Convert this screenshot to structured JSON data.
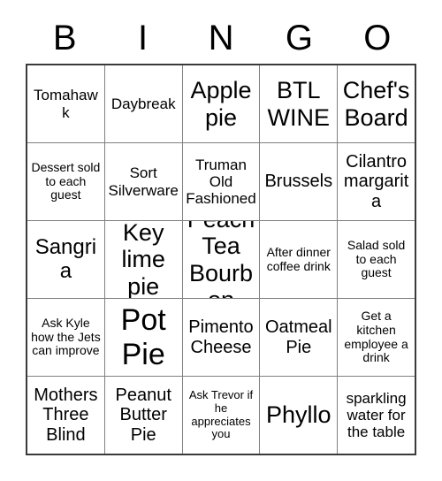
{
  "card": {
    "header_letters": [
      "B",
      "I",
      "N",
      "G",
      "O"
    ],
    "columns": 5,
    "rows": 5,
    "colors": {
      "background": "#ffffff",
      "text": "#000000",
      "outer_border": "#3a3a3a",
      "inner_border": "#808080"
    },
    "cells": [
      [
        {
          "text": "Tomahawk",
          "size": "sm"
        },
        {
          "text": "Daybreak",
          "size": "sm"
        },
        {
          "text": "Apple pie",
          "size": "xl"
        },
        {
          "text": "BTL WINE",
          "size": "xl"
        },
        {
          "text": "Chef's Board",
          "size": "xl"
        }
      ],
      [
        {
          "text": "Dessert sold to each guest",
          "size": "xs"
        },
        {
          "text": "Sort Silverware",
          "size": "sm"
        },
        {
          "text": "Truman Old Fashioned",
          "size": "sm"
        },
        {
          "text": "Brussels",
          "size": "md"
        },
        {
          "text": "Cilantro margarita",
          "size": "md"
        }
      ],
      [
        {
          "text": "Sangria",
          "size": "lg"
        },
        {
          "text": "Key lime pie",
          "size": "xl"
        },
        {
          "text": "Peach Tea Bourbon",
          "size": "xl"
        },
        {
          "text": "After dinner coffee drink",
          "size": "xs"
        },
        {
          "text": "Salad sold to each guest",
          "size": "xs"
        }
      ],
      [
        {
          "text": "Ask Kyle how the Jets can improve",
          "size": "xs"
        },
        {
          "text": "Pot Pie",
          "size": "xxl"
        },
        {
          "text": "Pimento Cheese",
          "size": "md"
        },
        {
          "text": "Oatmeal Pie",
          "size": "md"
        },
        {
          "text": "Get a kitchen employee a drink",
          "size": "xs"
        }
      ],
      [
        {
          "text": "Mothers Three Blind",
          "size": "md"
        },
        {
          "text": "Peanut Butter Pie",
          "size": "md"
        },
        {
          "text": "Ask Trevor if he appreciates you",
          "size": "xxs"
        },
        {
          "text": "Phyllo",
          "size": "xl"
        },
        {
          "text": "sparkling water for the table",
          "size": "sm"
        }
      ]
    ]
  }
}
